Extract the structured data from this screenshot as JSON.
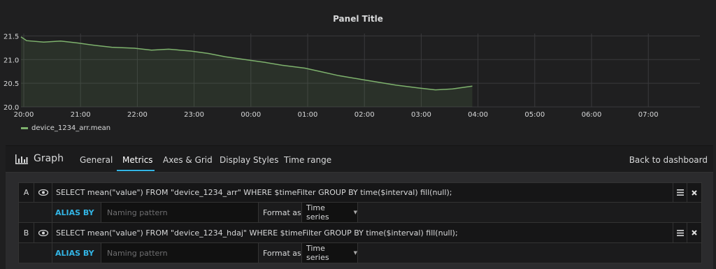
{
  "panel": {
    "title": "Panel Title",
    "legend_label": "device_1234_arr.mean",
    "series_color": "#7eb26d"
  },
  "chart_data": {
    "type": "area",
    "x_ticks": [
      "20:00",
      "21:00",
      "22:00",
      "23:00",
      "00:00",
      "01:00",
      "02:00",
      "03:00",
      "04:00",
      "05:00",
      "06:00",
      "07:00"
    ],
    "y_ticks": [
      "20.0",
      "20.5",
      "21.0",
      "21.5"
    ],
    "ylim": [
      20.0,
      21.55
    ],
    "grid": true,
    "series": [
      {
        "name": "device_1234_arr.mean",
        "x_hours": [
          0,
          0.1,
          0.4,
          0.7,
          1.0,
          1.3,
          1.6,
          2.0,
          2.3,
          2.6,
          3.0,
          3.3,
          3.6,
          4.0,
          4.3,
          4.6,
          5.0,
          5.3,
          5.6,
          6.0,
          6.3,
          6.6,
          7.0,
          7.3,
          7.6,
          7.95
        ],
        "values": [
          21.48,
          21.4,
          21.37,
          21.39,
          21.35,
          21.3,
          21.26,
          21.24,
          21.2,
          21.22,
          21.18,
          21.13,
          21.06,
          20.99,
          20.94,
          20.88,
          20.82,
          20.74,
          20.66,
          20.58,
          20.52,
          20.46,
          20.4,
          20.36,
          20.38,
          20.44
        ]
      }
    ]
  },
  "editor": {
    "header_title": "Graph",
    "tabs": [
      "General",
      "Metrics",
      "Axes & Grid",
      "Display Styles",
      "Time range"
    ],
    "active_tab": "Metrics",
    "back_link": "Back to dashboard"
  },
  "queries": [
    {
      "ref": "A",
      "query": "SELECT mean(\"value\") FROM \"device_1234_arr\" WHERE $timeFilter GROUP BY time($interval) fill(null);",
      "alias_label": "ALIAS BY",
      "alias_placeholder": "Naming pattern",
      "format_label": "Format as",
      "format_value": "Time series"
    },
    {
      "ref": "B",
      "query": "SELECT mean(\"value\") FROM \"device_1234_hdaj\" WHERE $timeFilter GROUP BY time($interval) fill(null);",
      "alias_label": "ALIAS BY",
      "alias_placeholder": "Naming pattern",
      "format_label": "Format as",
      "format_value": "Time series"
    }
  ],
  "icons": {
    "eye": "eye-icon",
    "menu": "hamburger-icon",
    "remove": "close-icon",
    "graph": "bar-chart-icon",
    "caret": "caret-down-icon"
  },
  "colors": {
    "accent": "#33b5e5",
    "background": "#1f1f20",
    "grid": "#3a3a3c"
  }
}
